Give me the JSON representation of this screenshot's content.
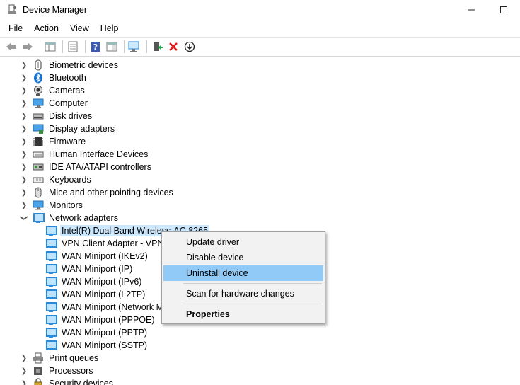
{
  "window": {
    "title": "Device Manager",
    "minimize_glyph": "—",
    "maximize_glyph": "☐"
  },
  "menu": [
    "File",
    "Action",
    "View",
    "Help"
  ],
  "toolbar": {
    "icons": [
      "back-arrow-icon",
      "forward-arrow-icon",
      "show-hide-console-tree-icon",
      "properties-icon",
      "help-icon",
      "show-view-icon",
      "scan-hardware-icon",
      "update-driver-icon",
      "uninstall-icon",
      "disable-device-icon"
    ]
  },
  "tree": {
    "categories": [
      {
        "label": "Biometric devices",
        "icon": "fingerprint-icon",
        "expanded": false
      },
      {
        "label": "Bluetooth",
        "icon": "bluetooth-icon",
        "expanded": false
      },
      {
        "label": "Cameras",
        "icon": "camera-icon",
        "expanded": false
      },
      {
        "label": "Computer",
        "icon": "monitor-icon",
        "expanded": false
      },
      {
        "label": "Disk drives",
        "icon": "disk-drive-icon",
        "expanded": false
      },
      {
        "label": "Display adapters",
        "icon": "display-adapter-icon",
        "expanded": false
      },
      {
        "label": "Firmware",
        "icon": "chip-icon",
        "expanded": false
      },
      {
        "label": "Human Interface Devices",
        "icon": "hid-icon",
        "expanded": false
      },
      {
        "label": "IDE ATA/ATAPI controllers",
        "icon": "controller-icon",
        "expanded": false
      },
      {
        "label": "Keyboards",
        "icon": "keyboard-icon",
        "expanded": false
      },
      {
        "label": "Mice and other pointing devices",
        "icon": "mouse-icon",
        "expanded": false
      },
      {
        "label": "Monitors",
        "icon": "monitor-icon",
        "expanded": false
      },
      {
        "label": "Network adapters",
        "icon": "network-adapter-icon",
        "expanded": true
      }
    ],
    "network_children": [
      "Intel(R) Dual Band Wireless-AC 8265",
      "VPN Client Adapter - VPN",
      "WAN Miniport (IKEv2)",
      "WAN Miniport (IP)",
      "WAN Miniport (IPv6)",
      "WAN Miniport (L2TP)",
      "WAN Miniport (Network M",
      "WAN Miniport (PPPOE)",
      "WAN Miniport (PPTP)",
      "WAN Miniport (SSTP)"
    ],
    "after_categories": [
      {
        "label": "Print queues",
        "icon": "printer-icon"
      },
      {
        "label": "Processors",
        "icon": "processor-icon"
      },
      {
        "label": "Security devices",
        "icon": "security-icon"
      }
    ]
  },
  "context_menu": {
    "items": [
      "Update driver",
      "Disable device",
      "Uninstall device",
      "Scan for hardware changes",
      "Properties"
    ],
    "highlighted": "Uninstall device"
  },
  "colors": {
    "selection": "#cce8ff",
    "menu_highlight": "#91c9f7",
    "network_icon": "#2a8ad8"
  }
}
